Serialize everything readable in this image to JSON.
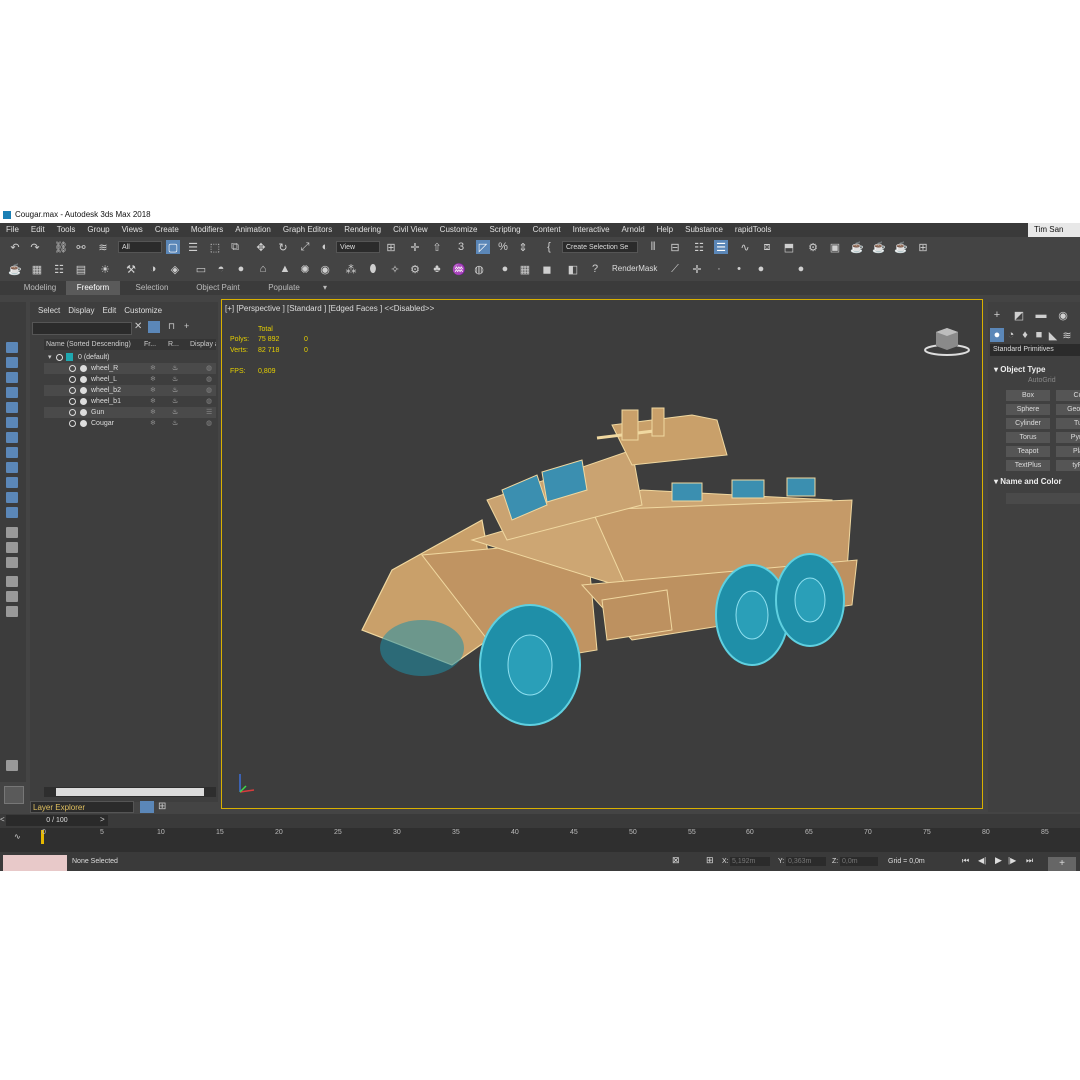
{
  "window": {
    "title": "Cougar.max - Autodesk 3ds Max 2018",
    "user": "Tim San"
  },
  "menu": [
    "File",
    "Edit",
    "Tools",
    "Group",
    "Views",
    "Create",
    "Modifiers",
    "Animation",
    "Graph Editors",
    "Rendering",
    "Civil View",
    "Customize",
    "Scripting",
    "Content",
    "Interactive",
    "Arnold",
    "Help",
    "Substance",
    "rapidTools"
  ],
  "toolbar": {
    "filter_value": "All",
    "view_value": "View",
    "selection_set": "Create Selection Se",
    "render_mask": "RenderMask"
  },
  "ribbon_tabs": [
    "Modeling",
    "Freeform",
    "Selection",
    "Object Paint",
    "Populate"
  ],
  "ribbon_active": "Freeform",
  "scene_explorer": {
    "menu": [
      "Select",
      "Display",
      "Edit",
      "Customize"
    ],
    "columns": [
      "Name (Sorted Descending)",
      "Fr...",
      "R...",
      "Display a"
    ],
    "root": "0 (default)",
    "objects": [
      "wheel_R",
      "wheel_L",
      "wheel_b2",
      "wheel_b1",
      "Gun",
      "Cougar"
    ],
    "footer": "Layer Explorer"
  },
  "viewport": {
    "label": "[+] [Perspective ] [Standard ] [Edged Faces ]  <<Disabled>>",
    "stats": {
      "header": "Total",
      "polys_label": "Polys:",
      "polys": "75 892",
      "polys_sel": "0",
      "verts_label": "Verts:",
      "verts": "82 718",
      "verts_sel": "0",
      "fps_label": "FPS:",
      "fps": "0,809"
    }
  },
  "command_panel": {
    "dropdown": "Standard Primitives",
    "object_type_title": "Object Type",
    "autogrid": "AutoGrid",
    "buttons": [
      "Box",
      "Co",
      "Sphere",
      "GeoSp",
      "Cylinder",
      "Tu",
      "Torus",
      "Pyra",
      "Teapot",
      "Pla",
      "TextPlus",
      "tyFl"
    ],
    "name_color_title": "Name and Color"
  },
  "timeline": {
    "frame": "0 / 100",
    "ticks": [
      "0",
      "5",
      "10",
      "15",
      "20",
      "25",
      "30",
      "35",
      "40",
      "45",
      "50",
      "55",
      "60",
      "65",
      "70",
      "75",
      "80",
      "85"
    ]
  },
  "status": {
    "selection": "None Selected",
    "x_label": "X:",
    "x": "5,192m",
    "y_label": "Y:",
    "y": "0,363m",
    "z_label": "Z:",
    "z": "0,0m",
    "grid": "Grid = 0,0m"
  },
  "colors": {
    "accent": "#5b87b8",
    "viewport_border": "#d8b000",
    "vehicle": "#c9a06a",
    "wireframe": "#f0d8a0",
    "wheels": "#1f8fa8"
  }
}
